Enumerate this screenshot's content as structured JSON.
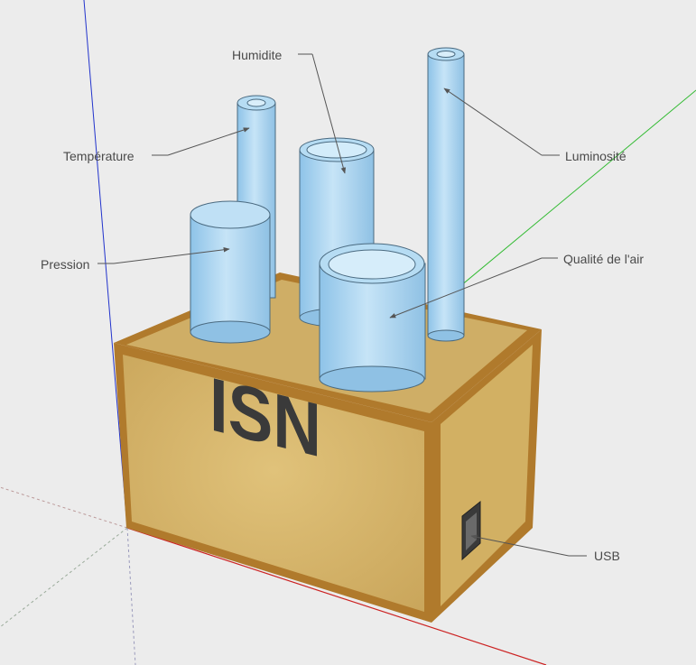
{
  "box": {
    "logo_text": "ISN"
  },
  "labels": {
    "humidite": "Humidite",
    "temperature": "Température",
    "luminosite": "Luminosité",
    "pression": "Pression",
    "qualite_air": "Qualité de l'air",
    "usb": "USB"
  },
  "colors": {
    "background": "#ececec",
    "wood": "#d7b466",
    "wood_frame": "#b07a2c",
    "tube": "#a9d2ee",
    "tube_edge": "#4a6a80",
    "leader": "#555555",
    "axis_blue": "#2233cc",
    "axis_green": "#33bb33",
    "axis_red": "#cc2222"
  }
}
